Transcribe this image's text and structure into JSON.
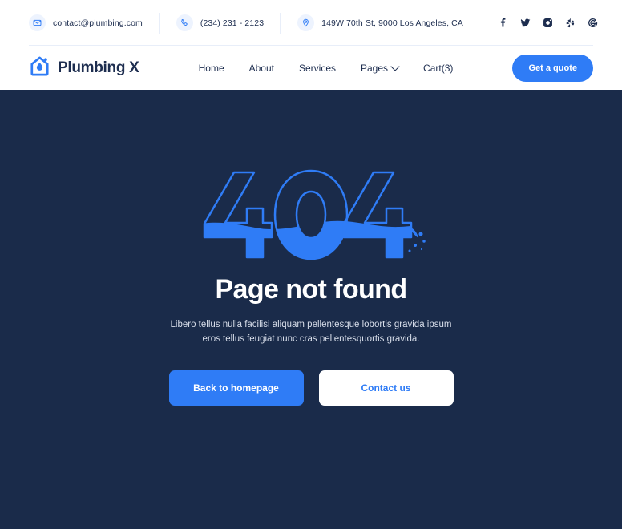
{
  "topbar": {
    "contacts": [
      {
        "icon": "mail-icon",
        "text": "contact@plumbing.com"
      },
      {
        "icon": "phone-icon",
        "text": "(234) 231 - 2123"
      },
      {
        "icon": "location-pin-icon",
        "text": "149W 70th St, 9000 Los Angeles, CA"
      }
    ],
    "socials": [
      {
        "name": "facebook-icon",
        "label": "Facebook"
      },
      {
        "name": "twitter-icon",
        "label": "Twitter"
      },
      {
        "name": "instagram-icon",
        "label": "Instagram"
      },
      {
        "name": "yelp-icon",
        "label": "Yelp"
      },
      {
        "name": "google-icon",
        "label": "Google"
      }
    ]
  },
  "nav": {
    "brand": "Plumbing X",
    "brand_icon": "house-water-drop-logo",
    "items": [
      {
        "label": "Home",
        "has_dropdown": false
      },
      {
        "label": "About",
        "has_dropdown": false
      },
      {
        "label": "Services",
        "has_dropdown": false
      },
      {
        "label": "Pages",
        "has_dropdown": true
      },
      {
        "label": "Cart(3)",
        "has_dropdown": false
      }
    ],
    "cta": "Get a quote"
  },
  "error_page": {
    "code": "404",
    "code_graphic": "404-water-fill-illustration",
    "headline": "Page not found",
    "description": "Libero tellus nulla facilisi aliquam pellentesque lobortis gravida ipsum eros tellus feugiat nunc cras pellentesquortis gravida.",
    "primary_button": "Back to homepage",
    "secondary_button": "Contact us"
  },
  "colors": {
    "accent_blue": "#2f7cf6",
    "dark_navy": "#1a2b4a",
    "icon_bg": "#edf3fe",
    "white": "#ffffff",
    "divider": "#e8eef9"
  }
}
